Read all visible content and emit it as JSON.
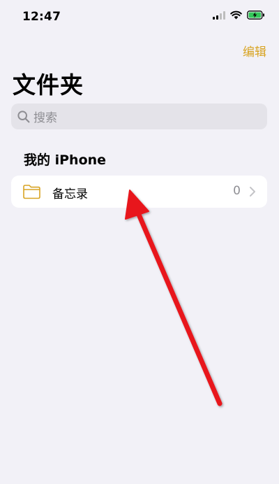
{
  "status_bar": {
    "time": "12:47"
  },
  "nav": {
    "edit_label": "编辑",
    "title": "文件夹"
  },
  "search": {
    "placeholder": "搜索"
  },
  "sections": [
    {
      "header": "我的 iPhone",
      "folders": [
        {
          "name": "备忘录",
          "count": "0"
        }
      ]
    }
  ],
  "colors": {
    "accent": "#d8a423",
    "background": "#f2f1f7",
    "arrow": "#e8141b"
  },
  "icons": {
    "signal": "cellular-signal-icon",
    "wifi": "wifi-icon",
    "battery": "battery-charging-icon",
    "search": "search-icon",
    "folder": "folder-icon",
    "chevron": "chevron-right-icon"
  }
}
